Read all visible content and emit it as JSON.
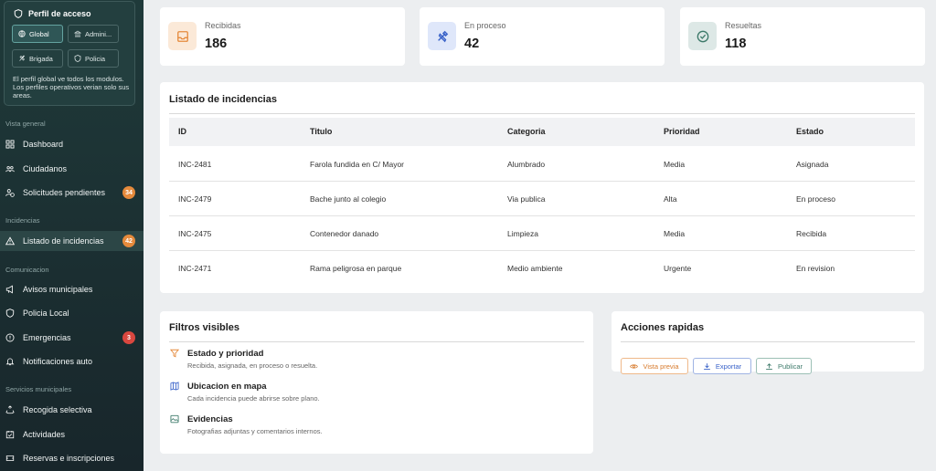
{
  "sidebar": {
    "profile": {
      "title": "Perfil de acceso",
      "buttons": [
        {
          "label": "Global"
        },
        {
          "label": "Admini..."
        },
        {
          "label": "Brigada"
        },
        {
          "label": "Policia"
        }
      ],
      "note": "El perfil global ve todos los modulos. Los perfiles operativos verian solo sus areas."
    },
    "sections": {
      "vista": "Vista general",
      "incidencias": "Incidencias",
      "comunicacion": "Comunicacion",
      "servicios": "Servicios municipales"
    },
    "items": [
      {
        "label": "Dashboard"
      },
      {
        "label": "Ciudadanos"
      },
      {
        "label": "Solicitudes pendientes",
        "badge": "34"
      },
      {
        "label": "Listado de incidencias",
        "badge": "42"
      },
      {
        "label": "Avisos municipales"
      },
      {
        "label": "Policia Local"
      },
      {
        "label": "Emergencias",
        "badge": "3"
      },
      {
        "label": "Notificaciones auto"
      },
      {
        "label": "Recogida selectiva"
      },
      {
        "label": "Actividades"
      },
      {
        "label": "Reservas e inscripciones"
      }
    ]
  },
  "stats": [
    {
      "label": "Recibidas",
      "value": "186"
    },
    {
      "label": "En proceso",
      "value": "42"
    },
    {
      "label": "Resueltas",
      "value": "118"
    }
  ],
  "incidents": {
    "title": "Listado de incidencias",
    "columns": [
      "ID",
      "Titulo",
      "Categoria",
      "Prioridad",
      "Estado"
    ],
    "rows": [
      [
        "INC-2481",
        "Farola fundida en C/ Mayor",
        "Alumbrado",
        "Media",
        "Asignada"
      ],
      [
        "INC-2479",
        "Bache junto al colegio",
        "Via publica",
        "Alta",
        "En proceso"
      ],
      [
        "INC-2475",
        "Contenedor danado",
        "Limpieza",
        "Media",
        "Recibida"
      ],
      [
        "INC-2471",
        "Rama peligrosa en parque",
        "Medio ambiente",
        "Urgente",
        "En revision"
      ]
    ]
  },
  "filters": {
    "title": "Filtros visibles",
    "items": [
      {
        "title": "Estado y prioridad",
        "desc": "Recibida, asignada, en proceso o resuelta."
      },
      {
        "title": "Ubicacion en mapa",
        "desc": "Cada incidencia puede abrirse sobre plano."
      },
      {
        "title": "Evidencias",
        "desc": "Fotografias adjuntas y comentarios internos."
      }
    ]
  },
  "actions": {
    "title": "Acciones rapidas",
    "buttons": [
      {
        "label": "Vista previa"
      },
      {
        "label": "Exportar"
      },
      {
        "label": "Publicar"
      }
    ]
  },
  "colors": {
    "accent_orange": "#e58a3c",
    "accent_blue": "#3a63c9",
    "accent_green": "#3d7a6a",
    "badge_red": "#d9473f",
    "sidebar_bg": "#1c3133"
  }
}
